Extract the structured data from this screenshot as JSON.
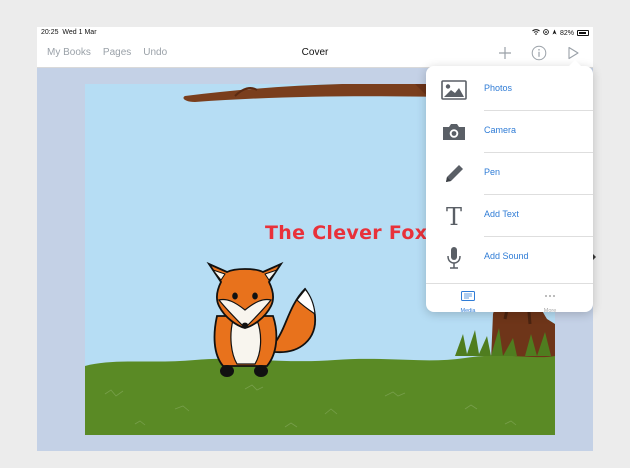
{
  "status_bar": {
    "time": "20:25",
    "date": "Wed 1 Mar",
    "battery": "82%",
    "battery_level": 0.82
  },
  "toolbar": {
    "my_books": "My Books",
    "pages": "Pages",
    "undo": "Undo",
    "title": "Cover",
    "add_icon": "plus-icon",
    "info_icon": "info-icon",
    "play_icon": "play-icon"
  },
  "book_page": {
    "title_text": "The Clever Fox"
  },
  "insert_menu": {
    "items": [
      {
        "label": "Photos",
        "icon": "photo-icon"
      },
      {
        "label": "Camera",
        "icon": "camera-icon"
      },
      {
        "label": "Pen",
        "icon": "pen-icon"
      },
      {
        "label": "Add Text",
        "icon": "text-icon"
      },
      {
        "label": "Add Sound",
        "icon": "microphone-icon"
      }
    ],
    "tabs": {
      "media": "Media",
      "more": "More"
    }
  },
  "colors": {
    "accent": "#2f7cd6",
    "sky": "#b6ddf4",
    "grass": "#5a8a25",
    "title": "#e8313a",
    "fox_orange": "#e8721c",
    "tree_brown": "#7a3e1d"
  }
}
